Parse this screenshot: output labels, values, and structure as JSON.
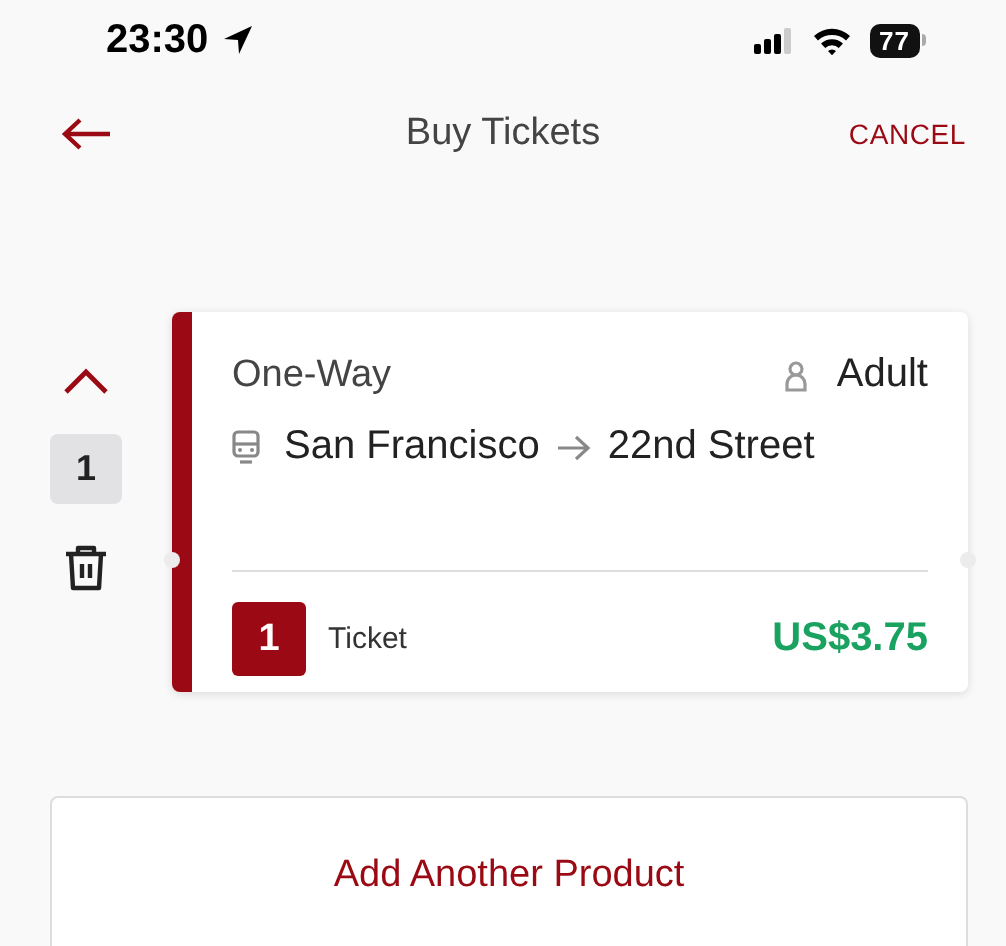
{
  "status_bar": {
    "time": "23:30",
    "battery": "77"
  },
  "header": {
    "title": "Buy Tickets",
    "cancel": "CANCEL"
  },
  "products": [
    {
      "quantity": "1",
      "expanded": true,
      "fare": "One-Way",
      "rider": "Adult",
      "origin": "San Francisco",
      "destination": "22nd Street",
      "count": "1",
      "unit": "Ticket",
      "price": "US$3.75"
    }
  ],
  "add_button": "Add Another Product"
}
